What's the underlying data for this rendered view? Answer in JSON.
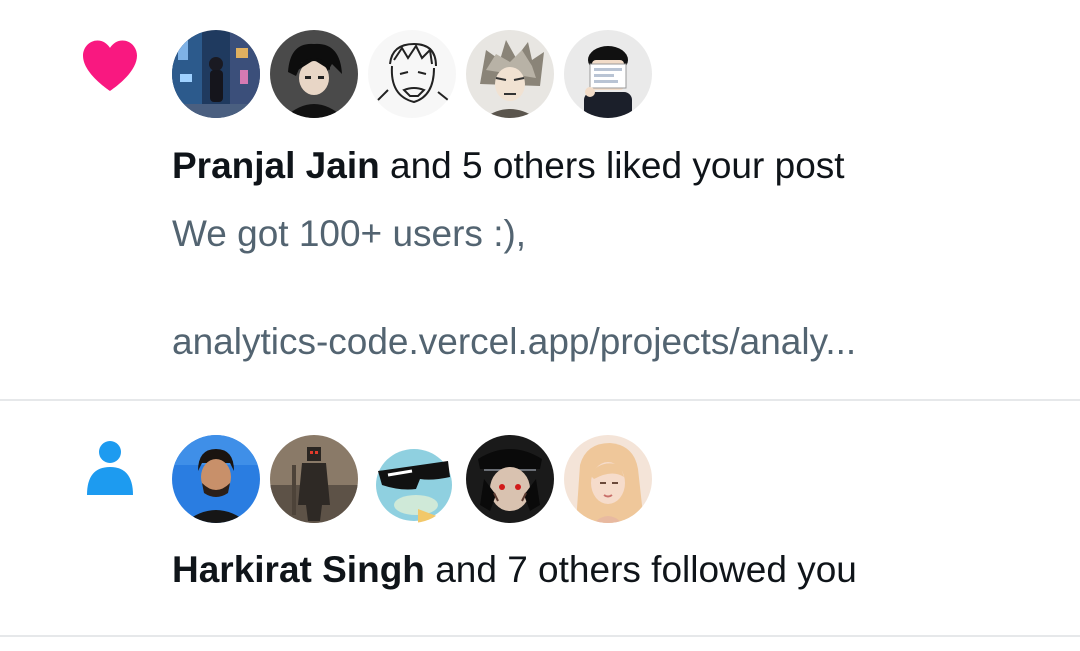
{
  "notifications": [
    {
      "type": "like",
      "type_icon": "heart-icon",
      "icon_color": "#f91880",
      "actor": "Pranjal Jain",
      "action_text": "and 5 others liked your post",
      "post_text_line1": "We got 100+ users :),",
      "post_text_line2": "analytics-code.vercel.app/projects/analy...",
      "avatars": [
        "avatar-photo-city-night",
        "avatar-anime-dark-hair",
        "avatar-sketch-manga",
        "avatar-anime-silver-hair",
        "avatar-cartoon-sign"
      ]
    },
    {
      "type": "follow",
      "type_icon": "person-icon",
      "icon_color": "#1d9bf0",
      "actor": "Harkirat Singh",
      "action_text": "and 7 others followed you",
      "avatars": [
        "avatar-photo-man",
        "avatar-dark-figure",
        "avatar-squirtle-sunglasses",
        "avatar-anime-itachi",
        "avatar-illustration-blonde"
      ]
    }
  ]
}
